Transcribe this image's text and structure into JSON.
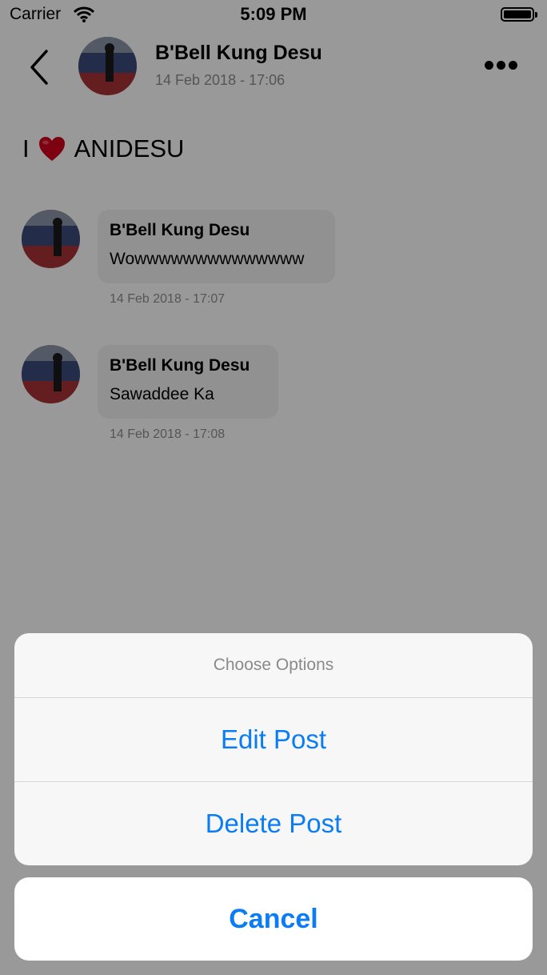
{
  "status_bar": {
    "carrier": "Carrier",
    "time": "5:09 PM"
  },
  "post": {
    "author": "B'Bell Kung Desu",
    "timestamp": "14 Feb 2018 - 17:06",
    "text_before": "I",
    "text_after": "ANIDESU"
  },
  "comments": [
    {
      "author": "B'Bell Kung Desu",
      "text": "Wowwwwwwwwwwwwww",
      "timestamp": "14 Feb 2018 - 17:07"
    },
    {
      "author": "B'Bell Kung Desu",
      "text": "Sawaddee Ka",
      "timestamp": "14 Feb 2018 - 17:08"
    }
  ],
  "action_sheet": {
    "title": "Choose Options",
    "edit_label": "Edit Post",
    "delete_label": "Delete Post",
    "cancel_label": "Cancel"
  },
  "colors": {
    "accent": "#0a7cf5",
    "heart": "#d0021b",
    "muted": "#8e8e93"
  }
}
